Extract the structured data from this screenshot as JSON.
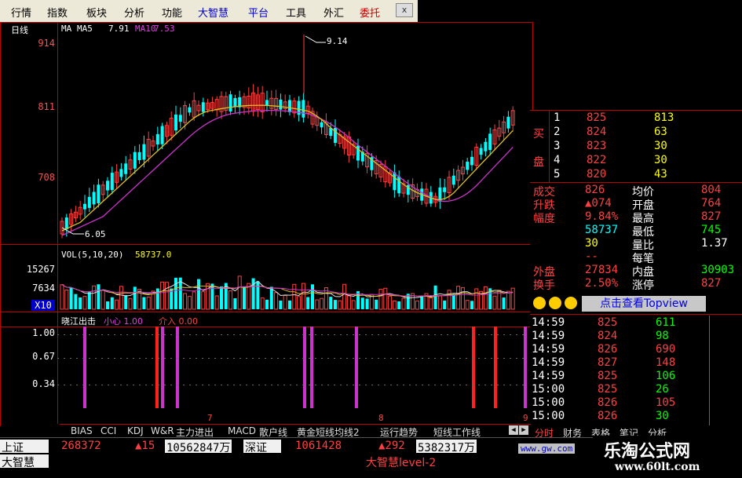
{
  "menu": {
    "items": [
      {
        "label": "行情",
        "color": "black"
      },
      {
        "label": "指数",
        "color": "black"
      },
      {
        "label": "板块",
        "color": "black"
      },
      {
        "label": "分析",
        "color": "black"
      },
      {
        "label": "功能",
        "color": "black"
      },
      {
        "label": "大智慧",
        "color": "blue"
      },
      {
        "label": "平台",
        "color": "blue"
      },
      {
        "label": "工具",
        "color": "black"
      },
      {
        "label": "外汇",
        "color": "black"
      },
      {
        "label": "委托",
        "color": "red"
      }
    ],
    "close_label": "x"
  },
  "main_chart": {
    "period": "日线",
    "ma_label": "MA",
    "ma5_label": "MA5",
    "ma5_value": "7.91",
    "ma10_label": "MA10",
    "ma10_value": "7.53",
    "y_ticks": [
      "914",
      "811",
      "708"
    ],
    "high_annotation": "9.14",
    "low_annotation": "6.05"
  },
  "volume": {
    "legend": "VOL(5,10,20)",
    "value": "58737.0",
    "y_ticks": [
      "15267",
      "7634"
    ],
    "unit": "X10"
  },
  "indicator": {
    "name": "晓江出击",
    "line1": "小心 1.00",
    "line2": "介入 0.00",
    "y_ticks": [
      "1.00",
      "0.67",
      "0.34"
    ],
    "axis_marks": [
      "7",
      "8",
      "9"
    ]
  },
  "order_book": {
    "buy_label": "买",
    "buy_label2": "盘",
    "levels": [
      {
        "level": "1",
        "price": "825",
        "volume": "813"
      },
      {
        "level": "2",
        "price": "824",
        "volume": "63"
      },
      {
        "level": "3",
        "price": "823",
        "volume": "30"
      },
      {
        "level": "4",
        "price": "822",
        "volume": "30"
      },
      {
        "level": "5",
        "price": "820",
        "volume": "43"
      }
    ]
  },
  "quote": {
    "rows": [
      {
        "l1": "成交",
        "v1": "826",
        "l2": "均价",
        "v2": "804"
      },
      {
        "l1": "升跌",
        "v1": "▲074",
        "l2": "开盘",
        "v2": "764"
      },
      {
        "l1": "幅度",
        "v1": "9.84%",
        "l2": "最高",
        "v2": "827"
      },
      {
        "l1": "",
        "v1": "58737",
        "l2": "最低",
        "v2": "745"
      },
      {
        "l1": "",
        "v1": "30",
        "l2": "量比",
        "v2": "1.37"
      },
      {
        "l1": "",
        "v1": "--",
        "l2": "每笔",
        "v2": ""
      },
      {
        "l1": "外盘",
        "v1": "27834",
        "l2": "内盘",
        "v2": "30903"
      },
      {
        "l1": "换手",
        "v1": "2.50%",
        "l2": "涨停",
        "v2": "827"
      }
    ],
    "topview_label": "点击查看Topview"
  },
  "ticks": [
    {
      "time": "14:59",
      "price": "825",
      "vol": "611"
    },
    {
      "time": "14:59",
      "price": "824",
      "vol": "98"
    },
    {
      "time": "14:59",
      "price": "826",
      "vol": "690"
    },
    {
      "time": "14:59",
      "price": "827",
      "vol": "148"
    },
    {
      "time": "14:59",
      "price": "825",
      "vol": "106"
    },
    {
      "time": "15:00",
      "price": "825",
      "vol": "26"
    },
    {
      "time": "15:00",
      "price": "826",
      "vol": "105"
    },
    {
      "time": "15:00",
      "price": "826",
      "vol": "30"
    }
  ],
  "tabs": [
    "BIAS",
    "CCI",
    "KDJ",
    "W&R",
    "主力进出",
    "MACD",
    "散户线",
    "黄金短线均线2",
    "运行趋势",
    "短线工作线"
  ],
  "side_tabs": [
    "分时",
    "财务",
    "表格",
    "笔记",
    "分析"
  ],
  "status": {
    "sh_label": "上证",
    "sh_value": "268372",
    "sh_change": "▲15",
    "sh_amount": "10562847万",
    "sz_label": "深证",
    "sz_value": "1061428",
    "sz_change": "▲292",
    "sz_amount": "5382317万",
    "brand_label": "大智慧",
    "brand_level": "大智慧level-2",
    "url": "www.gw.com"
  },
  "watermark": {
    "title": "乐淘公式网",
    "url": "www.60lt.com"
  },
  "colors": {
    "up": "#ff4040",
    "down": "#00ffff",
    "ma5": "#e0c020",
    "ma10": "#cc33cc"
  }
}
